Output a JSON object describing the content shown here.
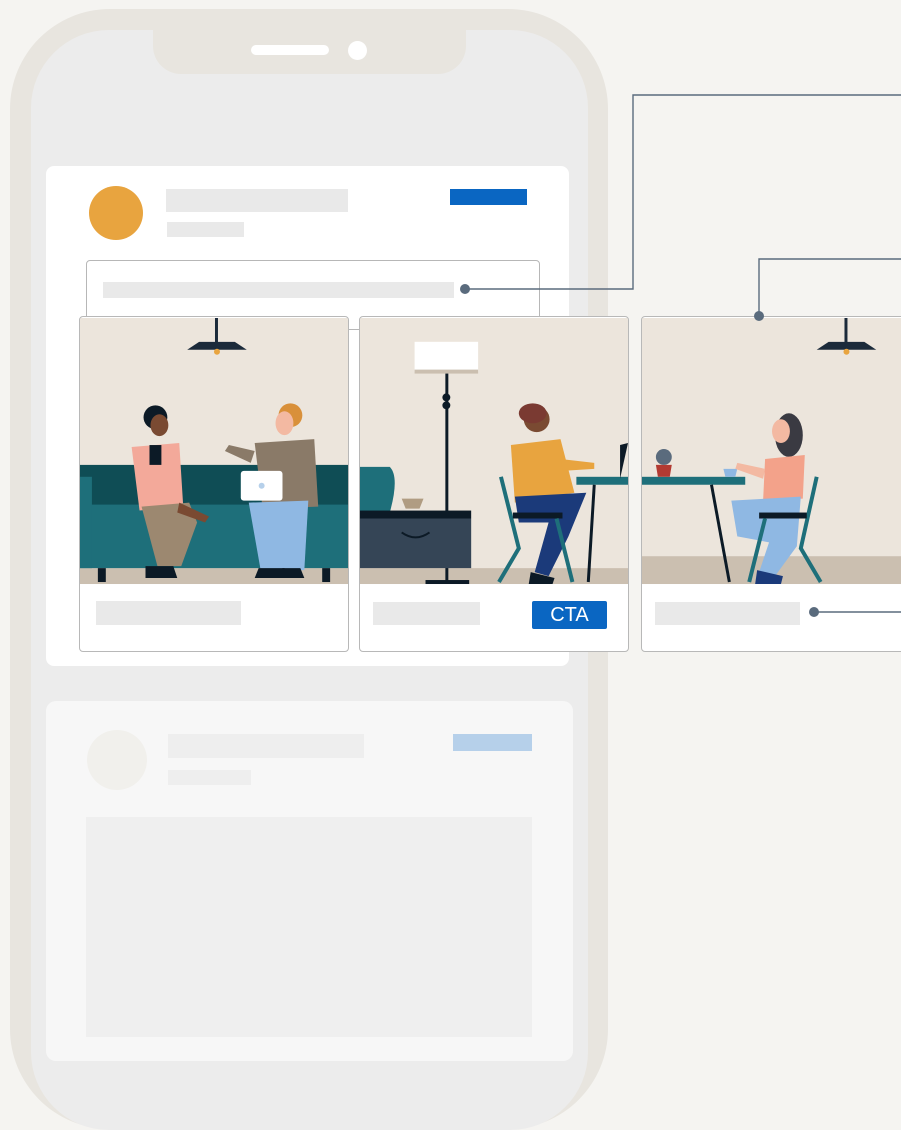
{
  "colors": {
    "avatar": "#e8a43f",
    "brand_blue": "#0a66c2",
    "faded_blue": "#b6d0ea",
    "sofa": "#1e6f7a",
    "sofa_back": "#0f4d55",
    "wall": "#ece5dc",
    "floor": "#cbbfb0",
    "callout_line": "#5a6b7d"
  },
  "icons": [
    "speaker-slot-icon",
    "camera-dot-icon",
    "lamp-icon",
    "laptop-icon",
    "plant-icon",
    "coffee-cup-icon"
  ],
  "carousel": {
    "cards": [
      {
        "scene": "two-people-on-sofa"
      },
      {
        "scene": "person-with-laptop-at-desk"
      },
      {
        "scene": "person-at-cafe-table"
      }
    ],
    "cta_label": "CTA"
  }
}
